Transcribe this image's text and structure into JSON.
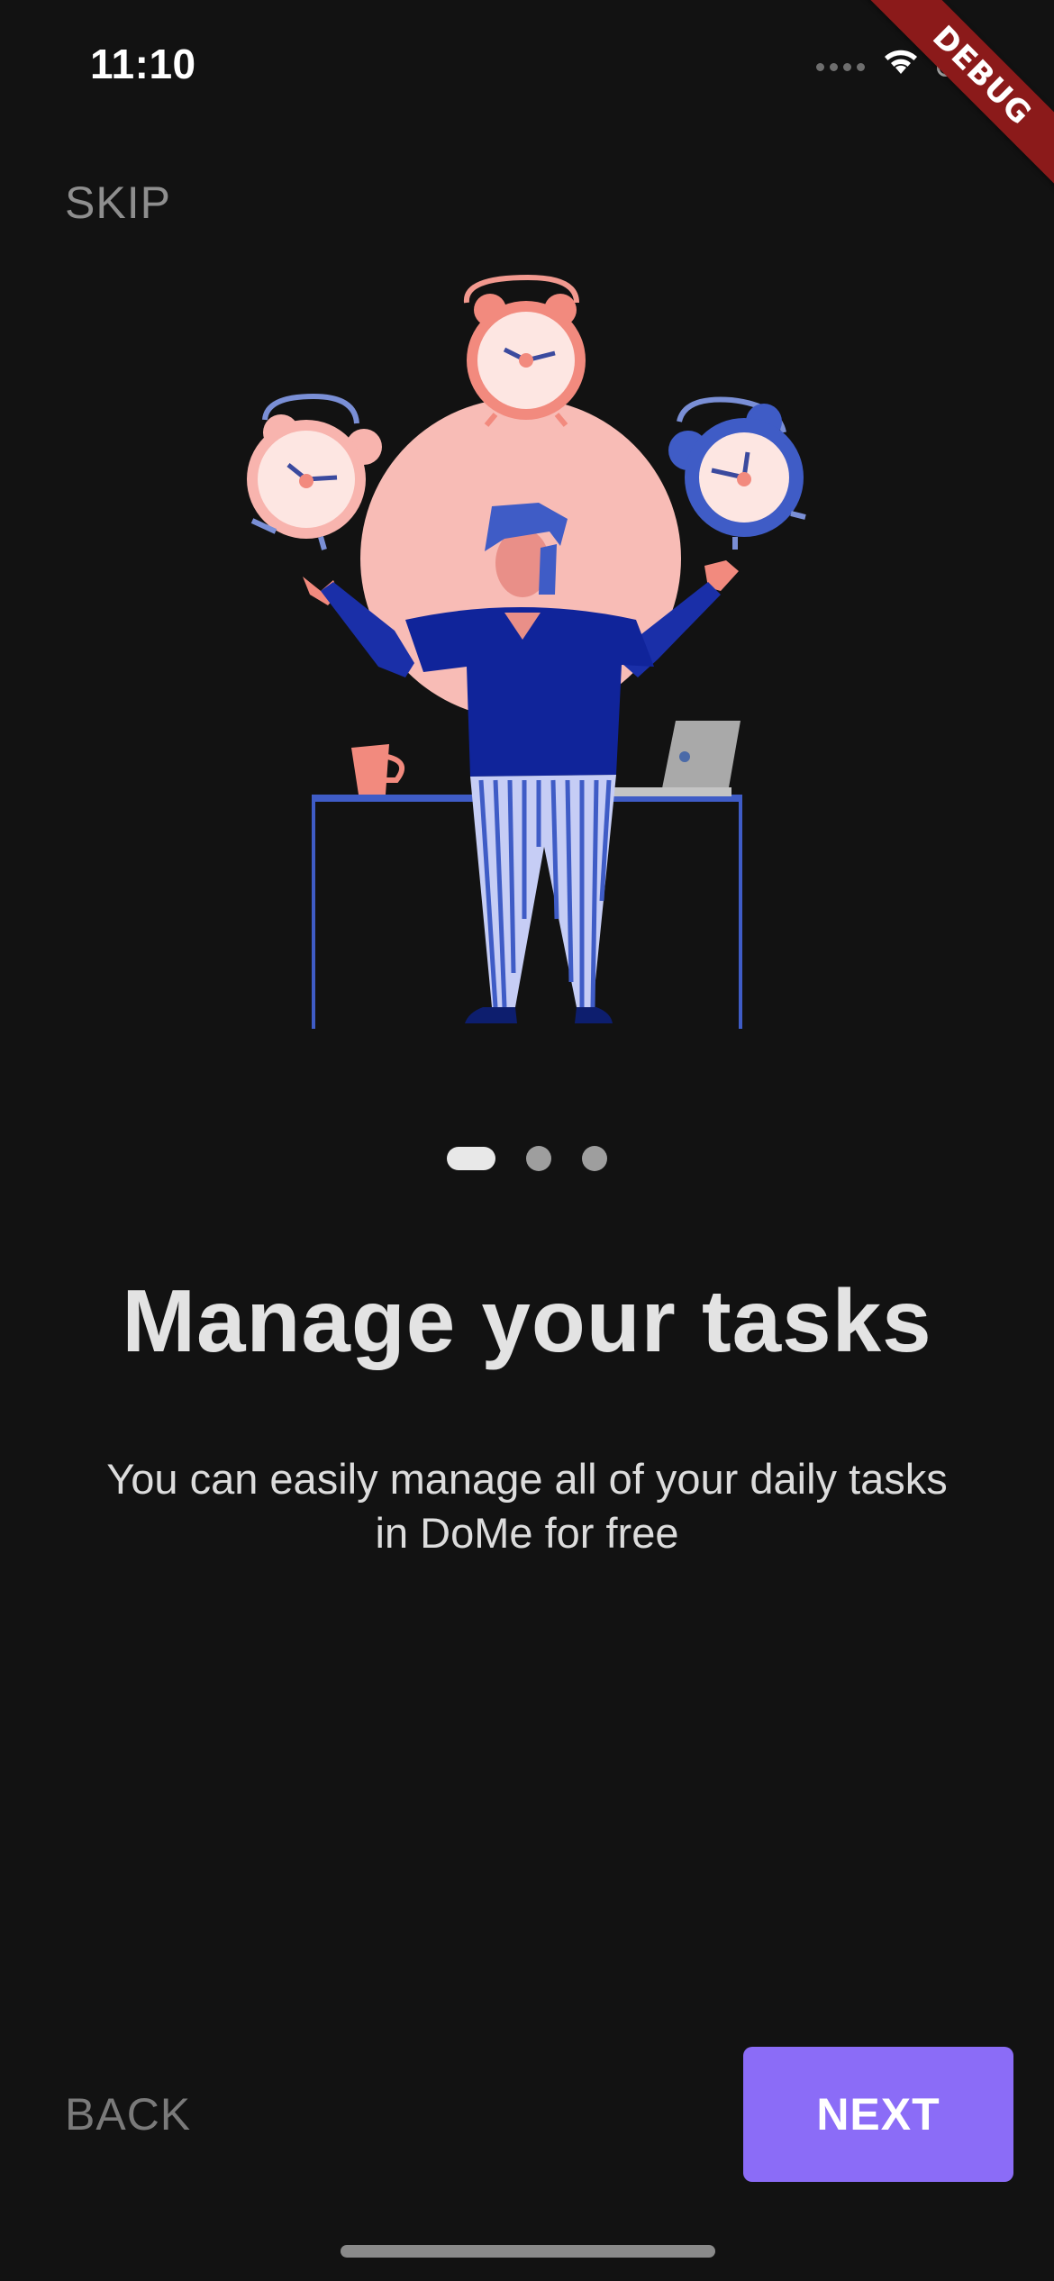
{
  "status_bar": {
    "time": "11:10",
    "icons": [
      "signal-dots",
      "wifi-icon",
      "battery-icon"
    ]
  },
  "debug_banner": {
    "label": "DEBUG",
    "color": "#8b1a1a"
  },
  "onboarding": {
    "skip_label": "SKIP",
    "illustration": "person-juggling-alarm-clocks",
    "page_indicator": {
      "total": 3,
      "current": 1
    },
    "title": "Manage your tasks",
    "subtitle": "You can easily manage all of your daily tasks in DoMe for free",
    "back_label": "BACK",
    "next_label": "NEXT"
  },
  "colors": {
    "background": "#121212",
    "accent": "#8b6cf7",
    "muted_text": "#8e8e8e"
  }
}
